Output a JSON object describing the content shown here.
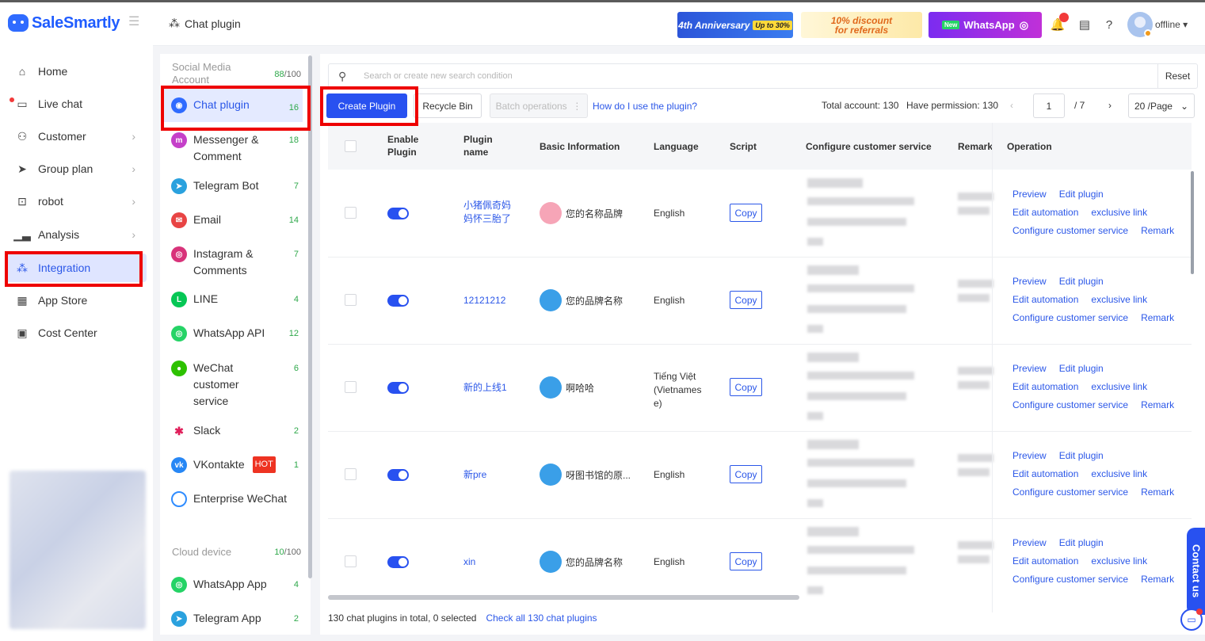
{
  "app": {
    "brand": "SaleSmartly"
  },
  "nav": [
    {
      "label": "Home",
      "icon": "home-icon"
    },
    {
      "label": "Live chat",
      "icon": "chat-icon"
    },
    {
      "label": "Customer",
      "icon": "users-icon"
    },
    {
      "label": "Group plan",
      "icon": "send-icon"
    },
    {
      "label": "robot",
      "icon": "robot-icon"
    },
    {
      "label": "Analysis",
      "icon": "chart-icon"
    },
    {
      "label": "Integration",
      "icon": "integration-icon"
    },
    {
      "label": "App Store",
      "icon": "grid-icon"
    },
    {
      "label": "Cost Center",
      "icon": "wallet-icon"
    }
  ],
  "header": {
    "breadcrumb": "Chat plugin",
    "banner1": {
      "text": "4th Anniversary",
      "badge": "Up to 30%"
    },
    "banner2": {
      "line1": "10% discount",
      "line2": "for referrals"
    },
    "banner3": {
      "badge": "New",
      "text": "WhatsApp"
    },
    "user_status": "offline"
  },
  "channels": {
    "social_header": "Social Media Account",
    "social_count": "88",
    "social_total": "/100",
    "items": [
      {
        "label": "Chat plugin",
        "count": "16",
        "color": "#2f6bff"
      },
      {
        "label": "Messenger & Comment",
        "count": "18",
        "color": "#c540c9"
      },
      {
        "label": "Telegram Bot",
        "count": "7",
        "color": "#2aa1de"
      },
      {
        "label": "Email",
        "count": "14",
        "color": "#e84444"
      },
      {
        "label": "Instagram & Comments",
        "count": "7",
        "color": "#d8337a"
      },
      {
        "label": "LINE",
        "count": "4",
        "color": "#06c755"
      },
      {
        "label": "WhatsApp API",
        "count": "12",
        "color": "#25d366"
      },
      {
        "label": "WeChat customer service",
        "count": "6",
        "color": "#2dc100"
      },
      {
        "label": "Slack",
        "count": "2",
        "color": "#e01e5a"
      },
      {
        "label": "VKontakte",
        "count": "1",
        "color": "#2787f5",
        "badge": "HOT"
      },
      {
        "label": "Enterprise WeChat",
        "count": "",
        "color": "#2f8cff"
      }
    ],
    "cloud_header": "Cloud device",
    "cloud_count": "10",
    "cloud_total": "/100",
    "cloud_items": [
      {
        "label": "WhatsApp App",
        "count": "4",
        "color": "#25d366"
      },
      {
        "label": "Telegram App",
        "count": "2",
        "color": "#2aa1de"
      }
    ]
  },
  "search": {
    "placeholder": "Search or create new search condition",
    "reset": "Reset"
  },
  "toolbar": {
    "create": "Create Plugin",
    "recycle": "Recycle Bin",
    "batch": "Batch operations",
    "help": "How do I use the plugin?",
    "total_label": "Total account:",
    "total": "130",
    "perm_label": "Have permission:",
    "perm": "130",
    "page": "1",
    "pages": "/ 7",
    "per_page": "20 /Page"
  },
  "table": {
    "headers": {
      "enable": "Enable Plugin",
      "name": "Plugin name",
      "basic": "Basic Information",
      "language": "Language",
      "script": "Script",
      "service": "Configure customer service",
      "remark": "Remark",
      "operation": "Operation"
    },
    "rows": [
      {
        "name": "小猪佩奇妈妈怀三胎了",
        "brand": "您的名称品牌",
        "brand_color": "#f6a5b7",
        "language": "English",
        "script": "Copy"
      },
      {
        "name": "12121212",
        "brand": "您的品牌名称",
        "brand_color": "#3a9fe8",
        "language": "English",
        "script": "Copy"
      },
      {
        "name": "新的上线1",
        "brand": "啊哈哈",
        "brand_color": "#3a9fe8",
        "language": "Tiếng Việt (Vietnamese)",
        "script": "Copy"
      },
      {
        "name": "新pre",
        "brand": "呀图书馆的原...",
        "brand_color": "#3a9fe8",
        "language": "English",
        "script": "Copy"
      },
      {
        "name": "xin",
        "brand": "您的品牌名称",
        "brand_color": "#3a9fe8",
        "language": "English",
        "script": "Copy"
      }
    ],
    "ops": {
      "preview": "Preview",
      "edit": "Edit plugin",
      "automation": "Edit automation",
      "link": "exclusive link",
      "service": "Configure customer service",
      "remark": "Remark"
    }
  },
  "footer": {
    "summary": "130 chat plugins in total, 0 selected",
    "check_all": "Check all 130 chat plugins"
  },
  "contact": "Contact us"
}
